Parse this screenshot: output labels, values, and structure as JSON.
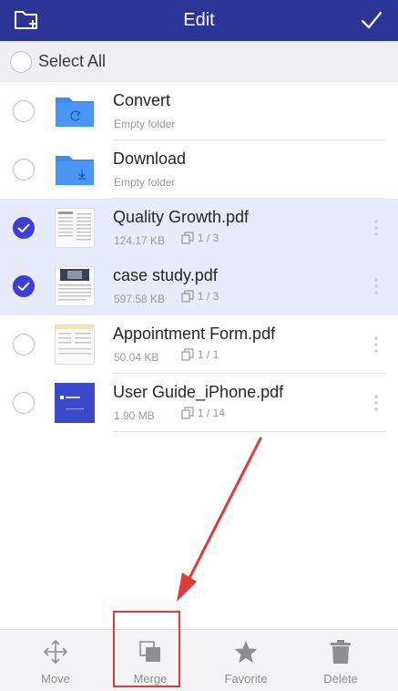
{
  "header": {
    "title": "Edit",
    "background": "#2b3595"
  },
  "select_all": {
    "label": "Select All"
  },
  "files": [
    {
      "name": "Convert",
      "sub": "Empty folder",
      "pages": "",
      "type": "folder",
      "folder_icon": "sync-icon",
      "selected": false
    },
    {
      "name": "Download",
      "sub": "Empty folder",
      "pages": "",
      "type": "folder",
      "folder_icon": "download-icon",
      "selected": false
    },
    {
      "name": "Quality Growth.pdf",
      "sub": "124.17 KB",
      "pages": "1 / 3",
      "type": "pdf",
      "selected": true
    },
    {
      "name": "case study.pdf",
      "sub": "597.58 KB",
      "pages": "1 / 3",
      "type": "pdf",
      "selected": true
    },
    {
      "name": "Appointment Form.pdf",
      "sub": "50.04 KB",
      "pages": "1 / 1",
      "type": "pdf",
      "selected": false
    },
    {
      "name": "User Guide_iPhone.pdf",
      "sub": "1.90 MB",
      "pages": "1 / 14",
      "type": "pdf",
      "selected": false
    }
  ],
  "toolbar": {
    "move_label": "Move",
    "merge_label": "Merge",
    "favorite_label": "Favorite",
    "delete_label": "Delete"
  },
  "colors": {
    "accent": "#3b3fd8",
    "selected_row": "#e8ebf9",
    "folder": "#3d8af0",
    "annotation": "#e23a3a"
  }
}
